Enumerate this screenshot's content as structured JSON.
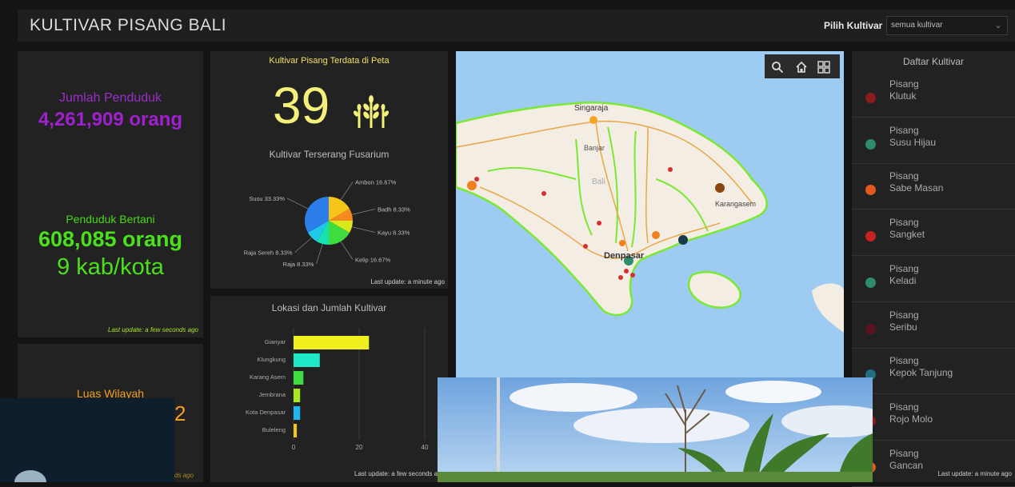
{
  "header": {
    "title": "KULTIVAR PISANG BALI",
    "pick_label": "Pilih Kultivar",
    "pick_value": "semua kultivar"
  },
  "population": {
    "label": "Jumlah Penduduk",
    "value": "4,261,909 orang"
  },
  "farmers": {
    "label": "Penduduk Bertani",
    "value": "608,085 orang",
    "regions": "9 kab/kota",
    "updated": "Last update: a few seconds ago"
  },
  "area": {
    "label": "Luas Wilayah",
    "value_partial": "2",
    "updated_partial": "ds ago"
  },
  "cultivar_count": {
    "title": "Kultivar Pisang Terdata di Peta",
    "value": "39",
    "icon": "wheat-icon"
  },
  "fusarium_chart": {
    "updated": "Last update: a minute ago"
  },
  "location_chart": {
    "updated": "Last update: a few seconds ago"
  },
  "map": {
    "labels": {
      "singaraja": "Singaraja",
      "bali": "Bali",
      "banjar": "Banjar",
      "karangasem": "Karangasem",
      "denpasar": "Denpasar"
    },
    "tools": [
      "search-icon",
      "home-icon",
      "grid-icon"
    ]
  },
  "cultivar_list": {
    "title": "Daftar Kultivar",
    "items": [
      {
        "line1": "Pisang",
        "line2": "Klutuk",
        "color": "#8a1d1d"
      },
      {
        "line1": "Pisang",
        "line2": "Susu Hijau",
        "color": "#2e8b6b"
      },
      {
        "line1": "Pisang",
        "line2": "Sabe Masan",
        "color": "#e05a1e"
      },
      {
        "line1": "Pisang",
        "line2": "Sangket",
        "color": "#c72222"
      },
      {
        "line1": "Pisang",
        "line2": "Keladi",
        "color": "#2e8b6b"
      },
      {
        "line1": "Pisang",
        "line2": "Seribu",
        "color": "#5a1420"
      },
      {
        "line1": "Pisang",
        "line2": "Kepok Tanjung",
        "color": "#1f6f80"
      },
      {
        "line1": "Pisang",
        "line2": "Rojo Molo",
        "color": "#8a1d1d"
      },
      {
        "line1": "Pisang",
        "line2": "Gancan",
        "color": "#e05a1e"
      }
    ],
    "updated": "Last update: a minute ago"
  },
  "chart_data": [
    {
      "type": "pie",
      "title": "Kultivar Terserang Fusarium",
      "slices": [
        {
          "label": "Ambon 16.67%",
          "value": 16.67,
          "color": "#f5c518"
        },
        {
          "label": "Badh 8.33%",
          "value": 8.33,
          "color": "#f58a1e"
        },
        {
          "label": "Kayu 8.33%",
          "value": 8.33,
          "color": "#d8e81a"
        },
        {
          "label": "Kelip 16.67%",
          "value": 16.67,
          "color": "#3fdc3f"
        },
        {
          "label": "Raja 8.33%",
          "value": 8.33,
          "color": "#19e0b0"
        },
        {
          "label": "Raja Sereh 8.33%",
          "value": 8.33,
          "color": "#1ec8e6"
        },
        {
          "label": "Susu 33.33%",
          "value": 33.33,
          "color": "#2c7fea"
        }
      ]
    },
    {
      "type": "bar",
      "title": "Lokasi dan Jumlah Kultivar",
      "categories": [
        "Gianyar",
        "Klungkung",
        "Karang Asem",
        "Jembrana",
        "Kota Denpasar",
        "Buleleng"
      ],
      "values": [
        23,
        8,
        3,
        2,
        2,
        1
      ],
      "colors": [
        "#f0f01e",
        "#1ee8c8",
        "#3fdc3f",
        "#a8e81e",
        "#1eb8f0",
        "#f5c518"
      ],
      "xticks": [
        "0",
        "20",
        "40"
      ],
      "xlim": [
        0,
        40
      ]
    }
  ]
}
